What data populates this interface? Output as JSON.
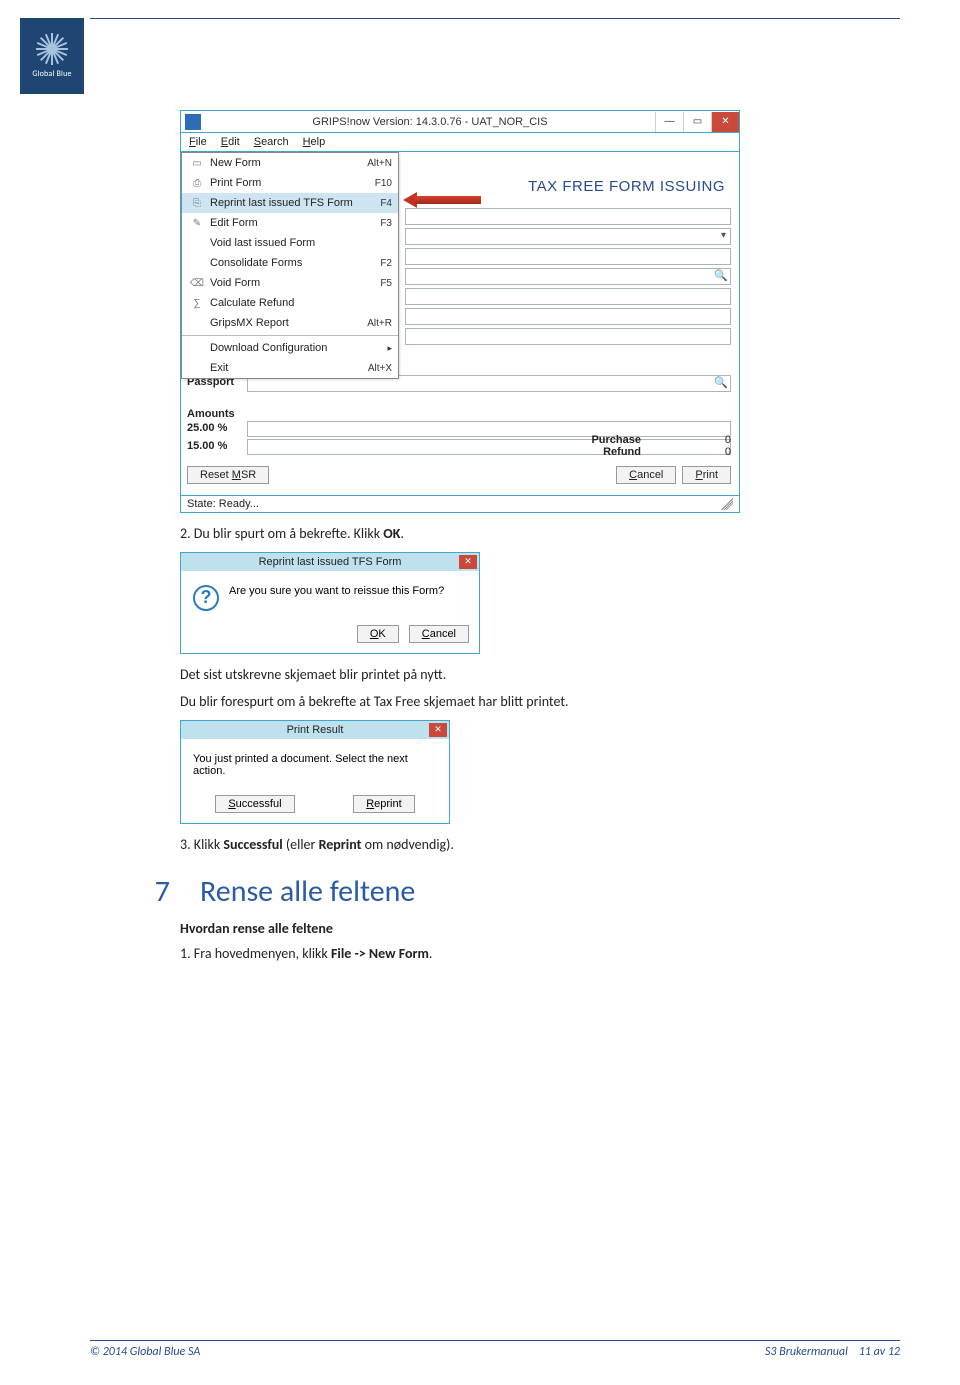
{
  "header": {
    "brand": "Global Blue"
  },
  "appwin": {
    "title": "GRIPS!now Version: 14.3.0.76 - UAT_NOR_CIS",
    "menubar": [
      "File",
      "Edit",
      "Search",
      "Help"
    ],
    "dropdown": [
      {
        "icon": "doc",
        "label": "New Form",
        "shortcut": "Alt+N"
      },
      {
        "icon": "print",
        "label": "Print Form",
        "shortcut": "F10"
      },
      {
        "icon": "reprint",
        "label": "Reprint last issued TFS Form",
        "shortcut": "F4",
        "selected": true
      },
      {
        "icon": "edit",
        "label": "Edit Form",
        "shortcut": "F3"
      },
      {
        "icon": "",
        "label": "Void last issued Form",
        "shortcut": ""
      },
      {
        "icon": "",
        "label": "Consolidate Forms",
        "shortcut": "F2"
      },
      {
        "icon": "void",
        "label": "Void Form",
        "shortcut": "F5"
      },
      {
        "icon": "calc",
        "label": "Calculate Refund",
        "shortcut": ""
      },
      {
        "icon": "",
        "label": "GripsMX Report",
        "shortcut": "Alt+R"
      },
      {
        "sep": true
      },
      {
        "icon": "",
        "label": "Download Configuration",
        "shortcut": "",
        "submenu": true
      },
      {
        "icon": "",
        "label": "Exit",
        "shortcut": "Alt+X"
      }
    ],
    "heading": "TAX FREE FORM ISSUING",
    "labels": {
      "passport": "Passport",
      "amounts": "Amounts",
      "rate1": "25.00 %",
      "rate2": "15.00 %",
      "purchase": "Purchase",
      "refund": "Refund"
    },
    "values": {
      "purchase": "0",
      "refund": "0"
    },
    "buttons": {
      "reset": "Reset MSR",
      "cancel": "Cancel",
      "print": "Print"
    },
    "status": "State: Ready..."
  },
  "step2": {
    "prefix": "2. Du blir spurt om å bekrefte. Klikk ",
    "bold": "OK",
    "suffix": "."
  },
  "dialog1": {
    "title": "Reprint last issued TFS Form",
    "message": "Are you sure you want to reissue this Form?",
    "ok": "OK",
    "cancel": "Cancel"
  },
  "mid_para": {
    "line1": "Det sist utskrevne skjemaet blir printet på nytt.",
    "line2": "Du blir forespurt om å bekrefte at Tax Free skjemaet har blitt printet."
  },
  "dialog2": {
    "title": "Print Result",
    "message": "You just printed a document. Select the next action.",
    "successful": "Successful",
    "reprint": "Reprint"
  },
  "step3": {
    "prefix": "3. Klikk ",
    "bold1": "Successful",
    "mid": " (eller ",
    "bold2": "Reprint",
    "suffix": " om nødvendig)."
  },
  "section7": {
    "num": "7",
    "title": "Rense alle feltene",
    "subhead": "Hvordan rense alle feltene",
    "step1_prefix": "1. Fra hovedmenyen, klikk ",
    "step1_bold": "File -> New Form",
    "step1_suffix": "."
  },
  "footer": {
    "left": "© 2014 Global Blue SA",
    "mid": "S3 Brukermanual",
    "right": "11 av 12"
  }
}
